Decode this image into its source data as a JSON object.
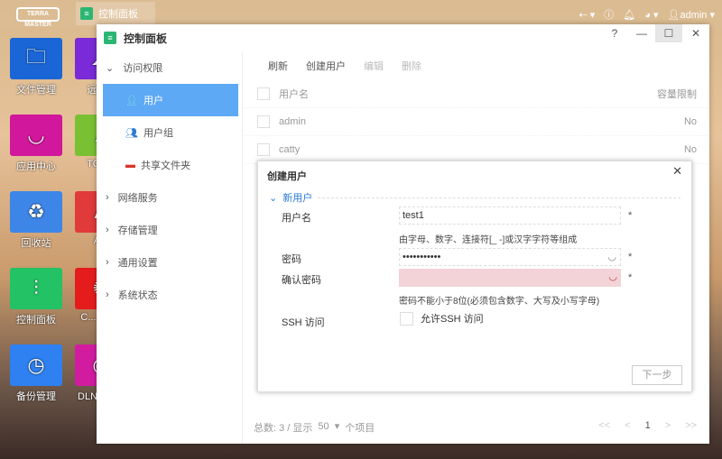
{
  "taskbar": {
    "logo": "TERRA MASTER",
    "active_tab": "控制面板",
    "user": "admin"
  },
  "desktop": [
    {
      "label": "文件管理",
      "color": "#1a66d6",
      "icon": "folder-icon"
    },
    {
      "label": "远程...",
      "color": "#7a2ad6",
      "icon": "cloud-icon"
    },
    {
      "label": "应用中心",
      "color": "#d1179b",
      "icon": "bag-icon"
    },
    {
      "label": "TOS...",
      "color": "#7ac033",
      "icon": "tos-icon"
    },
    {
      "label": "回收站",
      "color": "#3d86e8",
      "icon": "recycle-bin-icon"
    },
    {
      "label": "A...",
      "color": "#e03a3a",
      "icon": "app-icon"
    },
    {
      "label": "控制面板",
      "color": "#23c264",
      "icon": "sliders-icon"
    },
    {
      "label": "C... Ant...",
      "color": "#e51c1c",
      "icon": "antivirus-icon"
    },
    {
      "label": "备份管理",
      "color": "#2f80f0",
      "icon": "backup-clock-icon"
    },
    {
      "label": "DLNA 服...",
      "color": "#d11ca0",
      "icon": "dlna-icon"
    }
  ],
  "window": {
    "title": "控制面板",
    "help": "?",
    "min": "—",
    "max": "☐",
    "close": "✕"
  },
  "sidebar": {
    "groups": [
      {
        "label": "访问权限",
        "expanded": true
      },
      {
        "label": "网络服务"
      },
      {
        "label": "存储管理"
      },
      {
        "label": "通用设置"
      },
      {
        "label": "系统状态"
      }
    ],
    "items": [
      {
        "label": "用户",
        "active": true
      },
      {
        "label": "用户组"
      },
      {
        "label": "共享文件夹"
      }
    ]
  },
  "toolbar": {
    "refresh": "刷新",
    "create": "创建用户",
    "edit": "编辑",
    "delete": "删除"
  },
  "table": {
    "columns": [
      "用户名",
      "容量限制"
    ],
    "rows": [
      {
        "name": "admin",
        "quota": "No"
      },
      {
        "name": "catty",
        "quota": "No"
      }
    ]
  },
  "footer": {
    "total": "总数: 3 / 显示",
    "per_page": "50",
    "suffix": "个项目",
    "page": "1",
    "first": "<<",
    "prev": "<",
    "next": ">",
    "last": ">>"
  },
  "dialog": {
    "title": "创建用户",
    "close": "✕",
    "section": "新用户",
    "username_label": "用户名",
    "username_value": "test1",
    "username_hint": "由字母、数字、连接符[_ -]或汉字字符等组成",
    "password_label": "密码",
    "password_value": "•••••••••••",
    "confirm_label": "确认密码",
    "confirm_value": "",
    "password_hint": "密码不能小于8位(必须包含数字、大写及小写字母)",
    "ssh_label": "SSH 访问",
    "ssh_checkbox": "允许SSH 访问",
    "ssh_checked": false,
    "required": "*",
    "next": "下一步",
    "error_color": "#f3d3d8"
  }
}
